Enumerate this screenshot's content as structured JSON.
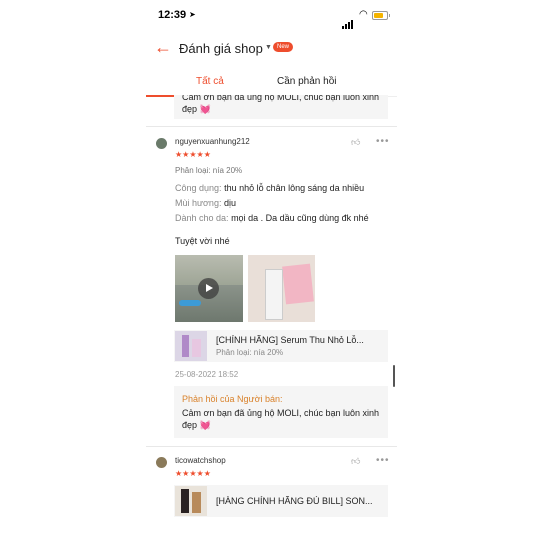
{
  "status": {
    "time": "12:39",
    "location_icon": "location-arrow-icon"
  },
  "header": {
    "title": "Đánh giá shop",
    "new_badge": "New"
  },
  "tabs": [
    {
      "label": "Tất cả"
    },
    {
      "label": "Cần phản hồi"
    }
  ],
  "top_reply": {
    "text": "Cảm ơn bạn đã ủng hộ MOLI, chúc bạn luôn xinh đẹp 💓"
  },
  "review1": {
    "username": "nguyenxuanhung212",
    "stars": "★★★★★",
    "variant": "Phân loại: nía 20%",
    "attributes": [
      {
        "key": "Công dụng:",
        "value": "thu nhỏ lỗ chân lông sáng da nhiều"
      },
      {
        "key": "Mùi hương:",
        "value": "dịu"
      },
      {
        "key": "Dành cho da:",
        "value": "mọi da  . Da dầu cũng dùng đk nhé"
      }
    ],
    "comment": "Tuyệt vời nhé",
    "product": {
      "name": "[CHÍNH HÃNG] Serum Thu Nhỏ Lỗ...",
      "variant": "Phân loại: nía 20%"
    },
    "date": "25-08-2022 18:52",
    "reply": {
      "label": "Phản hồi của Người bán:",
      "text": "Cảm ơn bạn đã ủng hộ MOLI, chúc bạn luôn xinh đẹp 💓"
    }
  },
  "review2": {
    "username": "ticowatchshop",
    "stars": "★★★★★",
    "product": {
      "name": "[HÀNG CHÍNH HÃNG ĐỦ BILL] SON..."
    }
  },
  "colors": {
    "accent": "#ee4d2d",
    "reply_label": "#d9822b"
  }
}
